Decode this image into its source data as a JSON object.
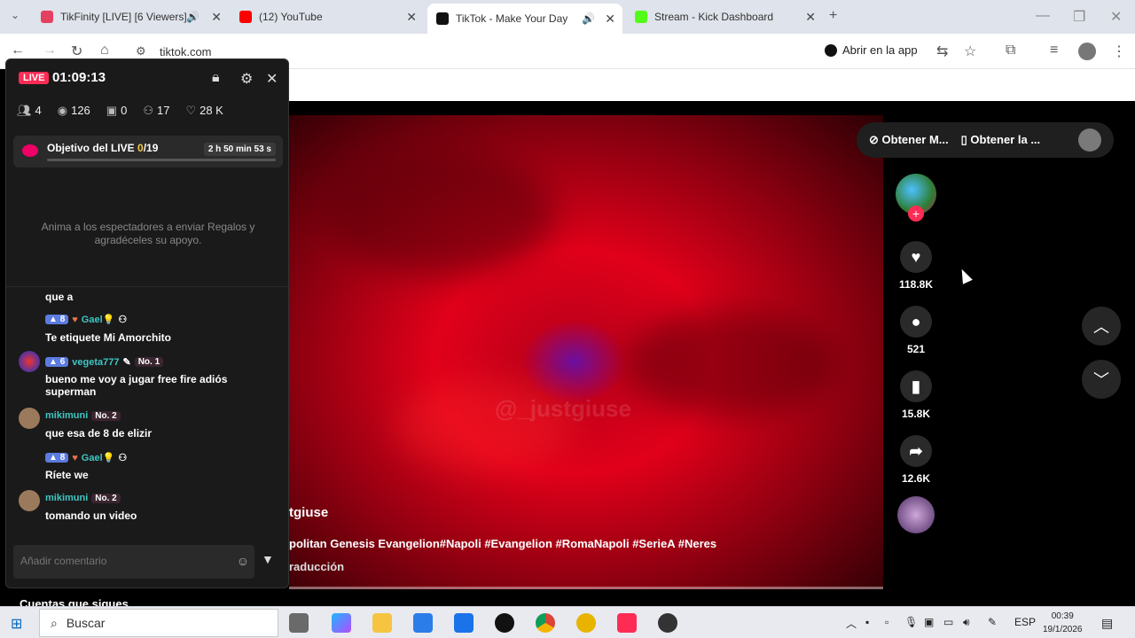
{
  "browser": {
    "tabs": [
      {
        "title": "TikFinity [LIVE] [6 Viewers]",
        "color": "#e4405f"
      },
      {
        "title": "(12) YouTube",
        "color": "#ff0000"
      },
      {
        "title": "TikTok - Make Your Day",
        "color": "#111111"
      },
      {
        "title": "Stream - Kick Dashboard",
        "color": "#53fc18"
      }
    ],
    "url": "tiktok.com",
    "open_in_app": "Abrir en la app"
  },
  "live_panel": {
    "badge": "LIVE",
    "timer": "01:09:13",
    "stats": {
      "friends": "4",
      "viewers": "126",
      "gifts": "0",
      "followers": "17",
      "likes": "28 K"
    },
    "goal": {
      "label": "Objetivo del LIVE ",
      "count": "0",
      "total": "/19",
      "time_left": "2 h 50 min 53 s"
    },
    "encourage": "Anima a los espectadores a enviar Regalos y agradéceles su apoyo.",
    "messages": [
      {
        "text": "que a"
      },
      {
        "level": "8",
        "user": "Gael💡",
        "text": "Te etiquete Mi Amorchito"
      },
      {
        "level": "6",
        "user": "vegeta777",
        "rank": "No. 1",
        "text": "bueno me voy a jugar free fire adiós superman"
      },
      {
        "user": "mikimuni",
        "rank": "No. 2",
        "text": "que esa de 8 de elizir"
      },
      {
        "level": "8",
        "user": "Gael💡",
        "text": "Ríete we"
      },
      {
        "user": "mikimuni",
        "rank": "No. 2",
        "text": "tomando un video"
      }
    ],
    "comment_placeholder": "Añadir comentario"
  },
  "video": {
    "watermark": "@_justgiuse",
    "author": "tgiuse",
    "description": "politan Genesis Evangelion#Napoli #Evangelion #RomaNapoli #SerieA #Neres",
    "translation": "raducción",
    "get_bar": {
      "left": "Obtener M...",
      "right": "Obtener la ..."
    }
  },
  "actions": {
    "likes": "118.8K",
    "comments": "521",
    "saves": "15.8K",
    "shares": "12.6K"
  },
  "follow_heading": "Cuentas que sigues",
  "taskbar": {
    "search": "Buscar",
    "lang": "ESP",
    "time": "00:39",
    "date": "19/1/2026"
  }
}
